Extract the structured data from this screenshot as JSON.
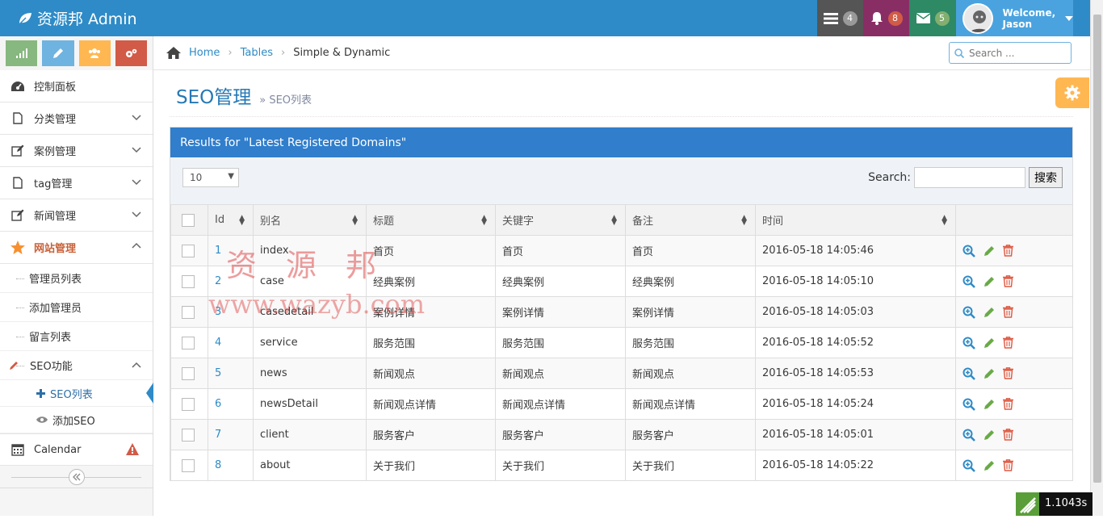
{
  "header": {
    "brand": "资源邦 Admin",
    "tasks_count": "4",
    "notifications_count": "8",
    "messages_count": "5",
    "welcome": "Welcome,",
    "username": "Jason"
  },
  "sidebar": {
    "items": [
      {
        "label": "控制面板",
        "icon": "dashboard-icon"
      },
      {
        "label": "分类管理",
        "icon": "file-icon"
      },
      {
        "label": "案例管理",
        "icon": "edit-icon"
      },
      {
        "label": "tag管理",
        "icon": "file-icon"
      },
      {
        "label": "新闻管理",
        "icon": "edit-icon"
      },
      {
        "label": "网站管理",
        "icon": "star-icon"
      }
    ],
    "sub_items": [
      "管理员列表",
      "添加管理员",
      "留言列表"
    ],
    "seo": {
      "label": "SEO功能",
      "sub": [
        "SEO列表",
        "添加SEO"
      ]
    },
    "calendar": "Calendar"
  },
  "breadcrumb": {
    "home": "Home",
    "tables": "Tables",
    "current": "Simple & Dynamic"
  },
  "search": {
    "placeholder": "Search ..."
  },
  "page": {
    "title": "SEO管理",
    "subtitle": "SEO列表"
  },
  "panel": {
    "title": "Results for \"Latest Registered Domains\""
  },
  "table": {
    "page_size": "10",
    "search_label": "Search:",
    "search_button": "搜索",
    "columns": [
      "Id",
      "别名",
      "标题",
      "关键字",
      "备注",
      "时间"
    ],
    "rows": [
      {
        "id": "1",
        "alias": "index",
        "title": "首页",
        "keywords": "首页",
        "note": "首页",
        "time": "2016-05-18 14:05:46"
      },
      {
        "id": "2",
        "alias": "case",
        "title": "经典案例",
        "keywords": "经典案例",
        "note": "经典案例",
        "time": "2016-05-18 14:05:10"
      },
      {
        "id": "3",
        "alias": "casedetail",
        "title": "案例详情",
        "keywords": "案例详情",
        "note": "案例详情",
        "time": "2016-05-18 14:05:03"
      },
      {
        "id": "4",
        "alias": "service",
        "title": "服务范围",
        "keywords": "服务范围",
        "note": "服务范围",
        "time": "2016-05-18 14:05:52"
      },
      {
        "id": "5",
        "alias": "news",
        "title": "新闻观点",
        "keywords": "新闻观点",
        "note": "新闻观点",
        "time": "2016-05-18 14:05:53"
      },
      {
        "id": "6",
        "alias": "newsDetail",
        "title": "新闻观点详情",
        "keywords": "新闻观点详情",
        "note": "新闻观点详情",
        "time": "2016-05-18 14:05:24"
      },
      {
        "id": "7",
        "alias": "client",
        "title": "服务客户",
        "keywords": "服务客户",
        "note": "服务客户",
        "time": "2016-05-18 14:05:01"
      },
      {
        "id": "8",
        "alias": "about",
        "title": "关于我们",
        "keywords": "关于我们",
        "note": "关于我们",
        "time": "2016-05-18 14:05:22"
      }
    ]
  },
  "watermark": {
    "line1": "资源邦",
    "line2": "www.wazyb.com"
  },
  "timer": "1.1043s",
  "colors": {
    "header": "#2e8bc7",
    "panel_head": "#307ecc",
    "accent_orange": "#ffb752"
  }
}
